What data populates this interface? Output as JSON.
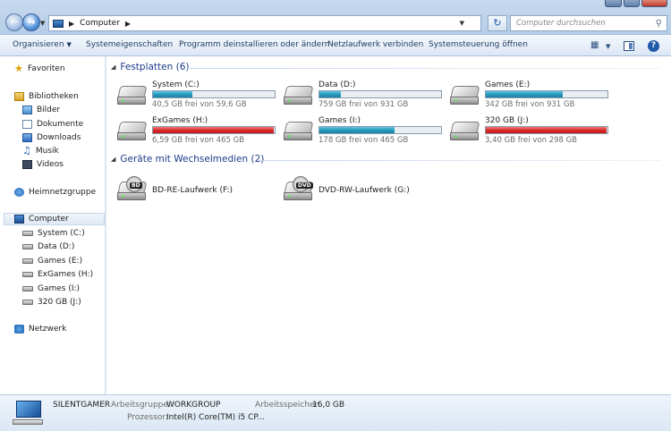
{
  "topbar": {
    "breadcrumb": "Computer",
    "search_placeholder": "Computer durchsuchen"
  },
  "commands": {
    "organize": "Organisieren",
    "properties": "Systemeigenschaften",
    "uninstall": "Programm deinstallieren oder ändern",
    "map_drive": "Netzlaufwerk verbinden",
    "control_panel": "Systemsteuerung öffnen"
  },
  "nav": {
    "favorites": "Favoriten",
    "libraries": "Bibliotheken",
    "pictures": "Bilder",
    "documents": "Dokumente",
    "downloads": "Downloads",
    "music": "Musik",
    "videos": "Videos",
    "homegroup": "Heimnetzgruppe",
    "computer": "Computer",
    "drives": [
      "System (C:)",
      "Data (D:)",
      "Games (E:)",
      "ExGames (H:)",
      "Games (I:)",
      "320 GB (J:)"
    ],
    "network": "Netzwerk"
  },
  "content": {
    "hdd_header": "Festplatten (6)",
    "removable_header": "Geräte mit Wechselmedien (2)",
    "hard_drives": [
      {
        "name": "System (C:)",
        "free": "40,5 GB frei von 59,6 GB",
        "used_fraction": 0.32,
        "warn": false
      },
      {
        "name": "Data (D:)",
        "free": "759 GB frei von 931 GB",
        "used_fraction": 0.18,
        "warn": false
      },
      {
        "name": "Games (E:)",
        "free": "342 GB frei von 931 GB",
        "used_fraction": 0.63,
        "warn": false
      },
      {
        "name": "ExGames (H:)",
        "free": "6,59 GB frei von 465 GB",
        "used_fraction": 0.99,
        "warn": true
      },
      {
        "name": "Games (I:)",
        "free": "178 GB frei von 465 GB",
        "used_fraction": 0.62,
        "warn": false
      },
      {
        "name": "320 GB (J:)",
        "free": "3,40 GB frei von 298 GB",
        "used_fraction": 0.99,
        "warn": true
      }
    ],
    "removable": [
      {
        "name": "BD-RE-Laufwerk (F:)",
        "badge": "BD"
      },
      {
        "name": "DVD-RW-Laufwerk (G:)",
        "badge": "DVD"
      }
    ]
  },
  "details": {
    "computer_name": "SILENTGAMER",
    "workgroup_label": "Arbeitsgruppe:",
    "workgroup_value": "WORKGROUP",
    "memory_label": "Arbeitsspeicher:",
    "memory_value": "16,0 GB",
    "cpu_label": "Prozessor:",
    "cpu_value": "Intel(R) Core(TM) i5 CP..."
  }
}
